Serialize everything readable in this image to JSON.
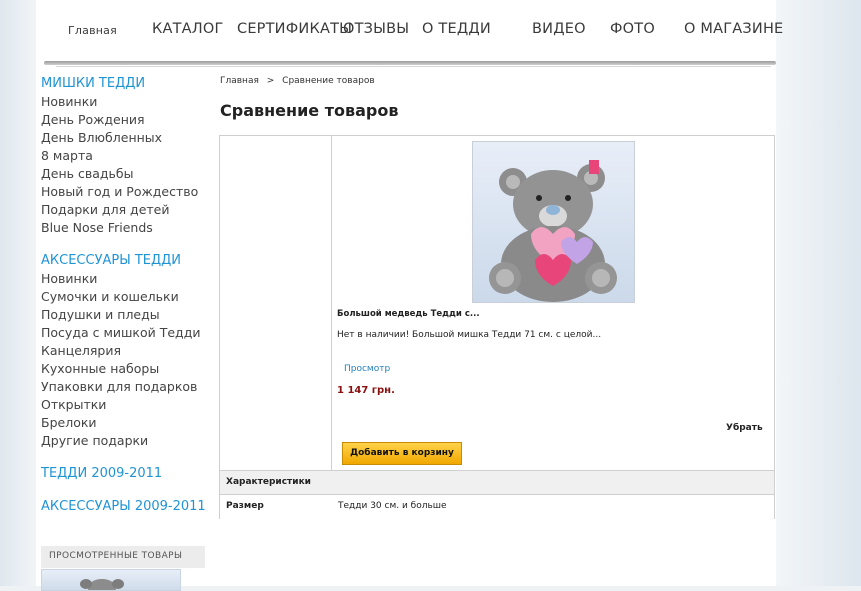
{
  "nav": {
    "items": [
      "Главная",
      "КАТАЛОГ",
      "СЕРТИФИКАТЫ",
      "ОТЗЫВЫ",
      "О ТЕДДИ",
      "ВИДЕО",
      "ФОТО",
      "О МАГАЗИНЕ"
    ]
  },
  "sidebar": {
    "groups": [
      {
        "title": "МИШКИ ТЕДДИ",
        "items": [
          "Новинки",
          "День Рождения",
          "День Влюбленных",
          "8 марта",
          "День свадьбы",
          "Новый год и Рождество",
          "Подарки для детей",
          "Blue Nose Friends"
        ]
      },
      {
        "title": "АКСЕССУАРЫ ТЕДДИ",
        "items": [
          "Новинки",
          "Сумочки и кошельки",
          "Подушки и пледы",
          "Посуда с мишкой Тедди",
          "Канцелярия",
          "Кухонные наборы",
          "Упаковки для подарков",
          "Открытки",
          "Брелоки",
          "Другие подарки"
        ]
      },
      {
        "title": "ТЕДДИ 2009-2011",
        "items": []
      },
      {
        "title": "АКСЕССУАРЫ 2009-2011",
        "items": []
      }
    ],
    "viewed_title": "ПРОСМОТРЕННЫЕ ТОВАРЫ"
  },
  "breadcrumb": {
    "home": "Главная",
    "separator": ">",
    "current": "Сравнение товаров"
  },
  "page_title": "Сравнение товаров",
  "product": {
    "name": "Большой медведь Тедди с...",
    "description": "Нет в наличии! Большой мишка Тедди 71 см. с целой...",
    "view_label": "Просмотр",
    "price": "1 147 грн.",
    "remove_label": "Убрать",
    "add_to_cart_label": "Добавить в корзину"
  },
  "table": {
    "header": "Характеристики",
    "rows": [
      {
        "label": "Размер",
        "value": "Тедди 30 см. и больше"
      }
    ]
  },
  "colors": {
    "link_blue": "#1f94d4",
    "price_red": "#8a1010",
    "button_yellow": "#f5b800"
  }
}
